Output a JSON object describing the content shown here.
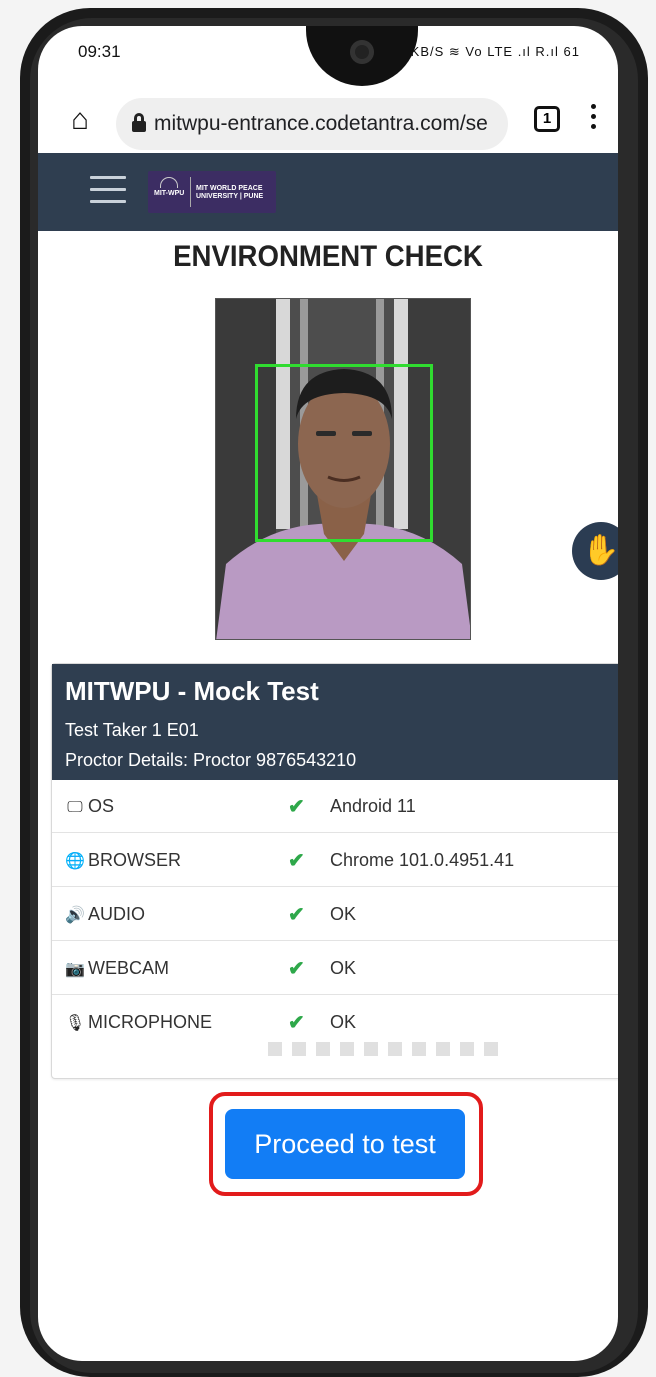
{
  "status_bar": {
    "time": "09:31",
    "icons_text": "✱ 63.0 KB/S ≋ Vo LTE .ıl R.ıl 61"
  },
  "browser": {
    "home_icon": "home-icon",
    "url": "mitwpu-entrance.codetantra.com/se",
    "tab_count": "1"
  },
  "header": {
    "logo_left": "MIT-WPU",
    "logo_right": "MIT WORLD PEACE UNIVERSITY | PUNE"
  },
  "page": {
    "title": "ENVIRONMENT CHECK"
  },
  "exam": {
    "name": "MITWPU - Mock Test",
    "taker": "Test Taker 1 E01",
    "proctor": "Proctor Details: Proctor 9876543210"
  },
  "checks": [
    {
      "icon": "monitor-icon",
      "label": "OS",
      "value": "Android 11"
    },
    {
      "icon": "globe-icon",
      "label": "BROWSER",
      "value": "Chrome 101.0.4951.41"
    },
    {
      "icon": "speaker-icon",
      "label": "AUDIO",
      "value": "OK"
    },
    {
      "icon": "camera-icon",
      "label": "WEBCAM",
      "value": "OK"
    },
    {
      "icon": "microphone-icon",
      "label": "MICROPHONE",
      "value": "OK"
    }
  ],
  "actions": {
    "proceed_label": "Proceed to test"
  },
  "colors": {
    "header_bg": "#2f3e50",
    "button_blue": "#127df5",
    "check_green": "#2ea84a",
    "highlight_red": "#e21b1b",
    "face_box_green": "#30dc30"
  }
}
